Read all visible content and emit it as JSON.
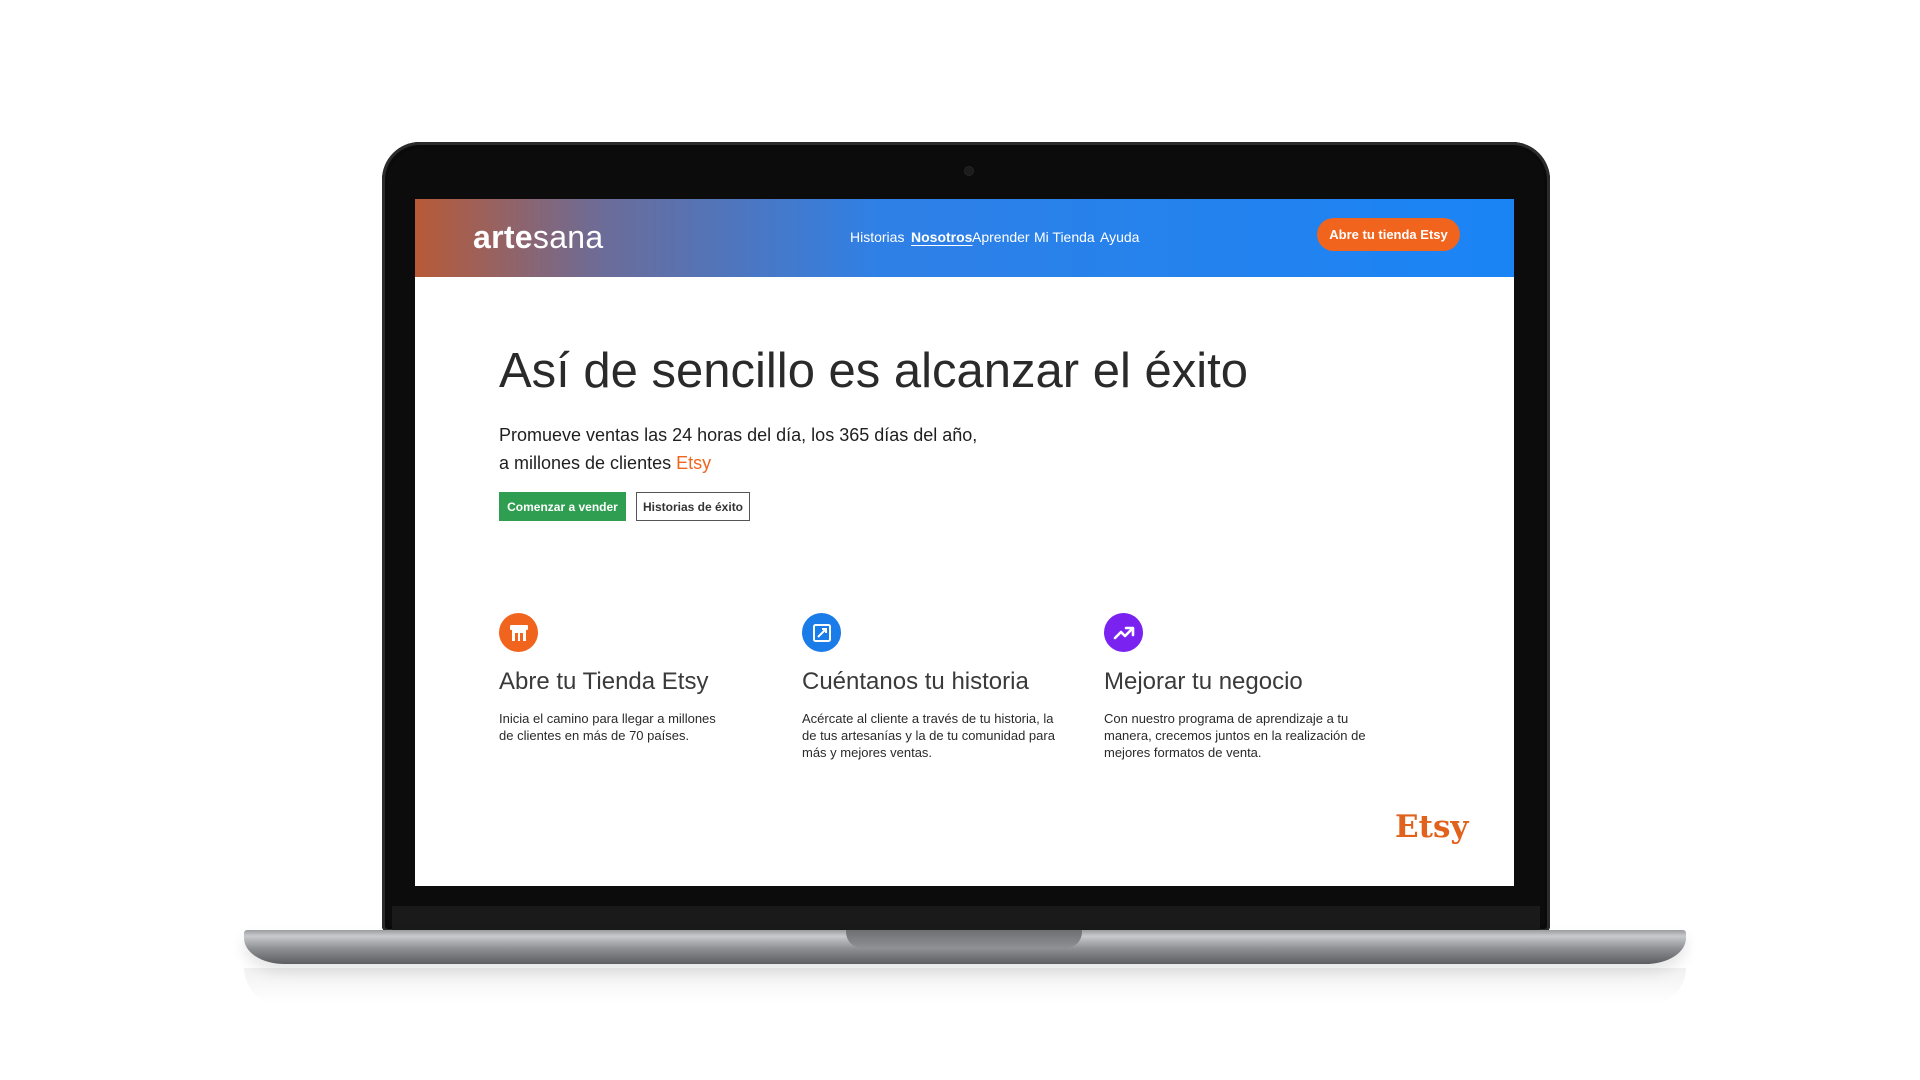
{
  "header": {
    "logo_bold": "arte",
    "logo_light": "sana",
    "nav": [
      {
        "label": "Historias"
      },
      {
        "label": "Nosotros"
      },
      {
        "label": "Aprender"
      },
      {
        "label": "Mi Tienda"
      },
      {
        "label": "Ayuda"
      }
    ],
    "active_nav": "Nosotros",
    "cta_label": "Abre tu tienda Etsy"
  },
  "hero": {
    "title": "Así de sencillo es alcanzar el éxito",
    "subtitle_line1": "Promueve ventas las 24 horas del día, los 365 días del año,",
    "subtitle_line2": "a millones de clientes ",
    "subtitle_accent": "Etsy",
    "primary_button": "Comenzar a vender",
    "secondary_button": "Historias de éxito"
  },
  "features": [
    {
      "icon": "shop-icon",
      "icon_color": "#f1641e",
      "title": "Abre tu Tienda Etsy",
      "text": "Inicia el camino para llegar a millones de clientes en más de 70 países."
    },
    {
      "icon": "edit-story-icon",
      "icon_color": "#1a7ce8",
      "title": "Cuéntanos tu historia",
      "text": "Acércate al cliente a través de tu historia, la de tus artesanías y la de tu comunidad para más y mejores ventas."
    },
    {
      "icon": "trending-up-icon",
      "icon_color": "#7a22f0",
      "title": "Mejorar tu negocio",
      "text": "Con nuestro programa de aprendizaje a tu manera, crecemos juntos en la realización de mejores formatos de venta."
    }
  ],
  "footer_logo": "Etsy",
  "colors": {
    "accent_orange": "#f1641e",
    "primary_green": "#2f9e50",
    "nav_blue": "#1a84f5"
  }
}
